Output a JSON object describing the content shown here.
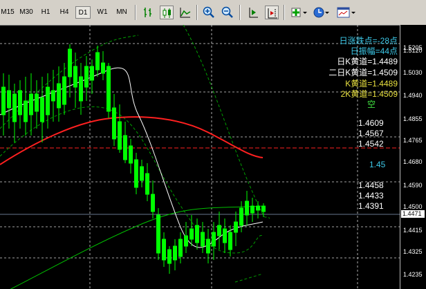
{
  "toolbar": {
    "timeframes": [
      {
        "label": "M15",
        "active": false
      },
      {
        "label": "M30",
        "active": false
      },
      {
        "label": "H1",
        "active": false
      },
      {
        "label": "H4",
        "active": false
      },
      {
        "label": "D1",
        "active": true
      },
      {
        "label": "W1",
        "active": false
      },
      {
        "label": "MN",
        "active": false
      }
    ],
    "buttons": [
      "bar-chart-icon",
      "candlestick-icon",
      "line-chart-icon",
      "zoom-in-icon",
      "zoom-out-icon",
      "chart-shift-icon",
      "autoscroll-icon",
      "indicators-icon",
      "periods-icon",
      "templates-icon"
    ]
  },
  "price_axis": {
    "ticks": [
      "1.5205",
      "1.5120",
      "1.5030",
      "1.4940",
      "1.4855",
      "1.4765",
      "1.4680",
      "1.4590",
      "1.4500",
      "1.4415",
      "1.4325",
      "1.4235"
    ],
    "current_price": "1.4471"
  },
  "annotations": {
    "info_lines": [
      {
        "text": "日涨跌点=-28点",
        "color": "#3cc8e8"
      },
      {
        "text": "日振幅=44点",
        "color": "#3cc8e8"
      },
      {
        "text": "日K黄道=1.4489",
        "color": "#ffffff"
      },
      {
        "text": "二日K黄道=1.4509",
        "color": "#ffffff"
      },
      {
        "text": "K黄道=1.4489",
        "color": "#e8e040"
      },
      {
        "text": "2K黄道=1.4509",
        "color": "#e8e040"
      },
      {
        "text": "空",
        "color": "#40e040"
      }
    ],
    "levels": [
      "1.4609",
      "1.4567",
      "1.4542"
    ],
    "mid_label": "1.45",
    "lower_levels": [
      "1.4458",
      "1.4433",
      "1.4391"
    ]
  },
  "colors": {
    "candle": "#00ff00",
    "ma_red": "#ff2020",
    "ma_green": "#00c000",
    "ma_white": "#ffffff",
    "bollinger": "#00a000",
    "grid": "#ffffff",
    "red_level": "#ff2020",
    "cyan": "#3cc8e8",
    "yellow": "#e8e040"
  }
}
